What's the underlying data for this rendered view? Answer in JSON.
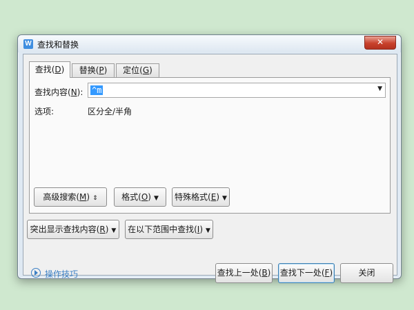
{
  "window": {
    "app_icon": "W",
    "title": "查找和替换",
    "close_glyph": "✕"
  },
  "tabs": [
    {
      "label": "查找(",
      "key": "D",
      "suffix": ")",
      "active": true
    },
    {
      "label": "替换(",
      "key": "P",
      "suffix": ")",
      "active": false
    },
    {
      "label": "定位(",
      "key": "G",
      "suffix": ")",
      "active": false
    }
  ],
  "find": {
    "label": "查找内容(",
    "label_key": "N",
    "label_suffix": "):",
    "value": "^m",
    "dropdown_icon": "triangle-down-icon"
  },
  "options": {
    "label": "选项:",
    "value": "区分全/半角"
  },
  "panel_buttons": {
    "advanced": {
      "label": "高级搜索(",
      "key": "M",
      "suffix": ")",
      "glyph": "⇕"
    },
    "format": {
      "label": "格式(",
      "key": "O",
      "suffix": ")",
      "glyph": "▼"
    },
    "special": {
      "label": "特殊格式(",
      "key": "E",
      "suffix": ")",
      "glyph": "▼"
    }
  },
  "lower_buttons": {
    "highlight": {
      "label": "突出显示查找内容(",
      "key": "R",
      "suffix": ")",
      "glyph": "▼"
    },
    "range": {
      "label": "在以下范围中查找(",
      "key": "I",
      "suffix": ")",
      "glyph": "▼"
    }
  },
  "tips": {
    "label": "操作技巧",
    "icon": "play-circle-icon"
  },
  "actions": {
    "prev": {
      "label": "查找上一处(",
      "key": "B",
      "suffix": ")"
    },
    "next": {
      "label": "查找下一处(",
      "key": "F",
      "suffix": ")"
    },
    "close": {
      "label": "关闭"
    }
  },
  "colors": {
    "accent": "#3399ff",
    "link": "#3b7fc4",
    "close_button": "#c8412c",
    "background": "#cfe8cf"
  }
}
